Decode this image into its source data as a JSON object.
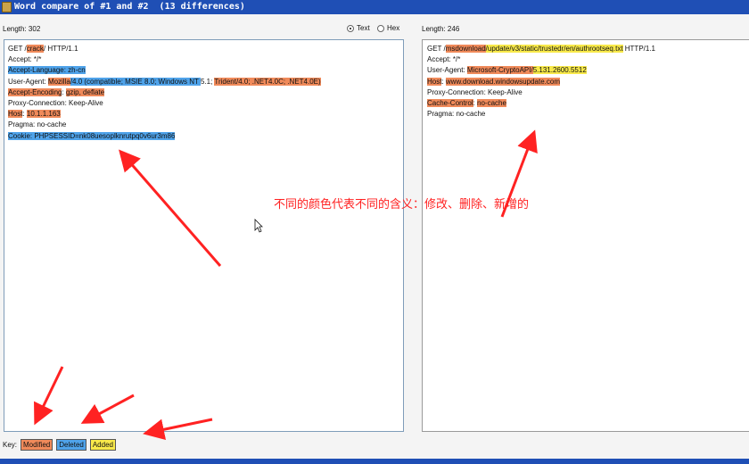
{
  "window": {
    "title": "Word compare of #1 and #2  (13 differences)"
  },
  "left": {
    "length_label": "Length: 302",
    "lines": [
      [
        {
          "t": "GET /"
        },
        {
          "t": "crack",
          "c": "m"
        },
        {
          "t": "/ HTTP/1.1"
        }
      ],
      [
        {
          "t": "Accept: */*"
        }
      ],
      [
        {
          "t": "Accept-Language: zh-cn",
          "c": "d"
        }
      ],
      [
        {
          "t": "User-Agent: "
        },
        {
          "t": "Mozilla",
          "c": "m"
        },
        {
          "t": "/4.0 (compatible; MSIE 8.0; Windows NT ",
          "c": "d"
        },
        {
          "t": "5.1; "
        },
        {
          "t": "Trident/4.0; .NET4.0C; .NET4.0E)",
          "c": "m"
        }
      ],
      [
        {
          "t": "Accept-Encoding",
          "c": "m"
        },
        {
          "t": ": "
        },
        {
          "t": "gzip, deflate",
          "c": "m"
        }
      ],
      [
        {
          "t": "Proxy-Connection: Keep-Alive"
        }
      ],
      [
        {
          "t": "Host",
          "c": "m"
        },
        {
          "t": ": "
        },
        {
          "t": "10.1.1.163",
          "c": "m"
        }
      ],
      [
        {
          "t": "Pragma: no-cache"
        }
      ],
      [
        {
          "t": "Cookie: PHPSESSID=nk08uesoplknrutpq0v6ur3m86",
          "c": "d"
        }
      ]
    ]
  },
  "right": {
    "length_label": "Length: 246",
    "lines": [
      [
        {
          "t": "GET /"
        },
        {
          "t": "msdownload",
          "c": "m"
        },
        {
          "t": "/update/v3/static/trustedr/en/authrootseq.txt",
          "c": "a"
        },
        {
          "t": " HTTP/1.1"
        }
      ],
      [
        {
          "t": "Accept: */*"
        }
      ],
      [
        {
          "t": "User-Agent: "
        },
        {
          "t": "Microsoft-CryptoAPI/",
          "c": "m"
        },
        {
          "t": "5.131.2600.5512",
          "c": "a"
        }
      ],
      [
        {
          "t": "Host",
          "c": "m"
        },
        {
          "t": ": "
        },
        {
          "t": "www.download.windowsupdate.com",
          "c": "m"
        }
      ],
      [
        {
          "t": "Proxy-Connection: Keep-Alive"
        }
      ],
      [
        {
          "t": "Cache-Control",
          "c": "m"
        },
        {
          "t": ": "
        },
        {
          "t": "no-cache",
          "c": "m"
        }
      ],
      [
        {
          "t": "Pragma: no-cache"
        }
      ]
    ]
  },
  "view_mode": {
    "text_label": "Text",
    "hex_label": "Hex",
    "selected": "Text"
  },
  "annotation": "不同的颜色代表不同的含义：修改、删除、新增的",
  "key": {
    "label": "Key:",
    "modified": "Modified",
    "deleted": "Deleted",
    "added": "Added"
  },
  "colors": {
    "modified": "#f08a5a",
    "deleted": "#4fa3ea",
    "added": "#f8e94a",
    "arrow": "#ff2222",
    "titlebar": "#1f4fb5"
  }
}
